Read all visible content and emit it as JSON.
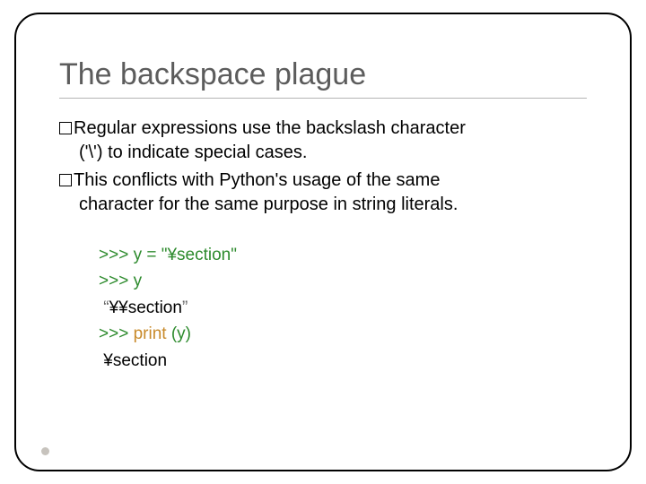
{
  "slide": {
    "title": "The backspace plague",
    "bullets": [
      {
        "lead": "Regular expressions use the backslash character",
        "cont": "('\\') to indicate special cases."
      },
      {
        "lead": "This conflicts with Python's usage of the same",
        "cont": "character for the same purpose in string literals."
      }
    ],
    "code": {
      "l1_prompt": ">>> ",
      "l1_assign": "y = \"¥section\"",
      "l2_prompt": ">>> ",
      "l2_expr": "y",
      "l3_quote_open": " “",
      "l3_val": "¥¥section",
      "l3_quote_close": "”",
      "l4_prompt": ">>> ",
      "l4_call": "print ",
      "l4_arg": "(y)",
      "l5_val": " ¥section"
    }
  }
}
